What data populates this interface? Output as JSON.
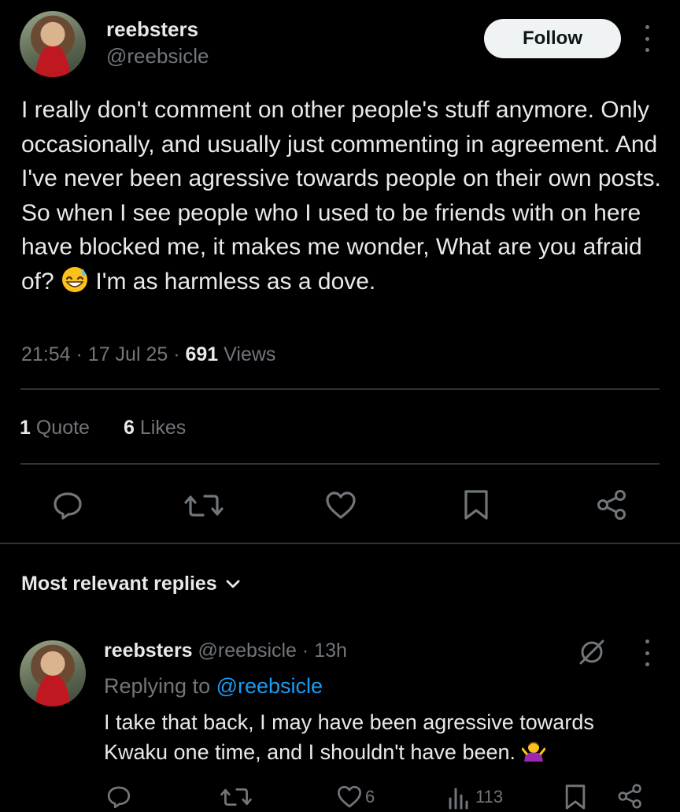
{
  "post": {
    "author_name": "reebsters",
    "author_handle": "@reebsicle",
    "follow_label": "Follow",
    "text": "I really don't comment on other people's stuff anymore. Only occasionally, and usually just commenting in agreement. And I've never been agressive towards people on their own posts. So when I see people who I used to be friends with on here have blocked me, it makes me wonder, What are you afraid of?",
    "text_after_emoji": " I'm as harmless as a dove.",
    "emoji": "grinning-face-with-sweat",
    "time": "21:54",
    "date": "17 Jul 25",
    "views_count": "691",
    "views_label": "Views",
    "meta_separator": "·"
  },
  "stats": {
    "quotes_count": "1",
    "quotes_label": "Quote",
    "likes_count": "6",
    "likes_label": "Likes"
  },
  "actions": {
    "icons": [
      "reply-icon",
      "repost-icon",
      "like-icon",
      "bookmark-icon",
      "share-icon"
    ]
  },
  "replies_section": {
    "heading": "Most relevant replies"
  },
  "reply": {
    "author_name": "reebsters",
    "author_handle": "@reebsicle",
    "time": "13h",
    "separator": "·",
    "replying_to_label": "Replying to",
    "replying_to_handle": "@reebsicle",
    "text": "I take that back, I may have been agressive towards Kwaku one time, and I shouldn't have been.",
    "emoji": "person-shrugging",
    "likes_count": "6",
    "views_count": "113"
  },
  "colors": {
    "background": "#000000",
    "text": "#e7e9ea",
    "muted": "#71767b",
    "link": "#1d9bf0",
    "divider": "#2f3336",
    "follow_bg": "#eff3f4"
  }
}
